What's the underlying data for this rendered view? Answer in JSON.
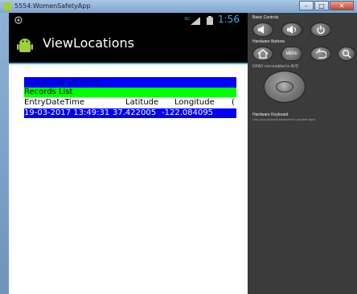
{
  "window": {
    "title": "5554:WomenSafetyApp"
  },
  "statusbar": {
    "signal": "3G",
    "time": "1:56"
  },
  "actionbar": {
    "title": "ViewLocations"
  },
  "content": {
    "heading": "LOCATION DETAILS",
    "records_label": "Records List",
    "columns": [
      "EntryDateTime",
      "Latitude",
      "Longitude",
      "("
    ],
    "rows": [
      {
        "datetime": "19-03-2017 13:49:31",
        "latitude": "37.422005",
        "longitude": "-122.084095"
      }
    ]
  },
  "controls": {
    "basic_label": "Basic Controls",
    "hardware_label": "Hardware Buttons",
    "dpad_label": "DPAD not enabled in AVD",
    "keyboard_label": "Hardware Keyboard",
    "keyboard_note": "Use your physical keyboard to provide input",
    "menu_label": "MENU"
  },
  "colors": {
    "accent": "#33b5e5",
    "heading_bg": "#0000ff",
    "records_bg": "#00ff00"
  }
}
